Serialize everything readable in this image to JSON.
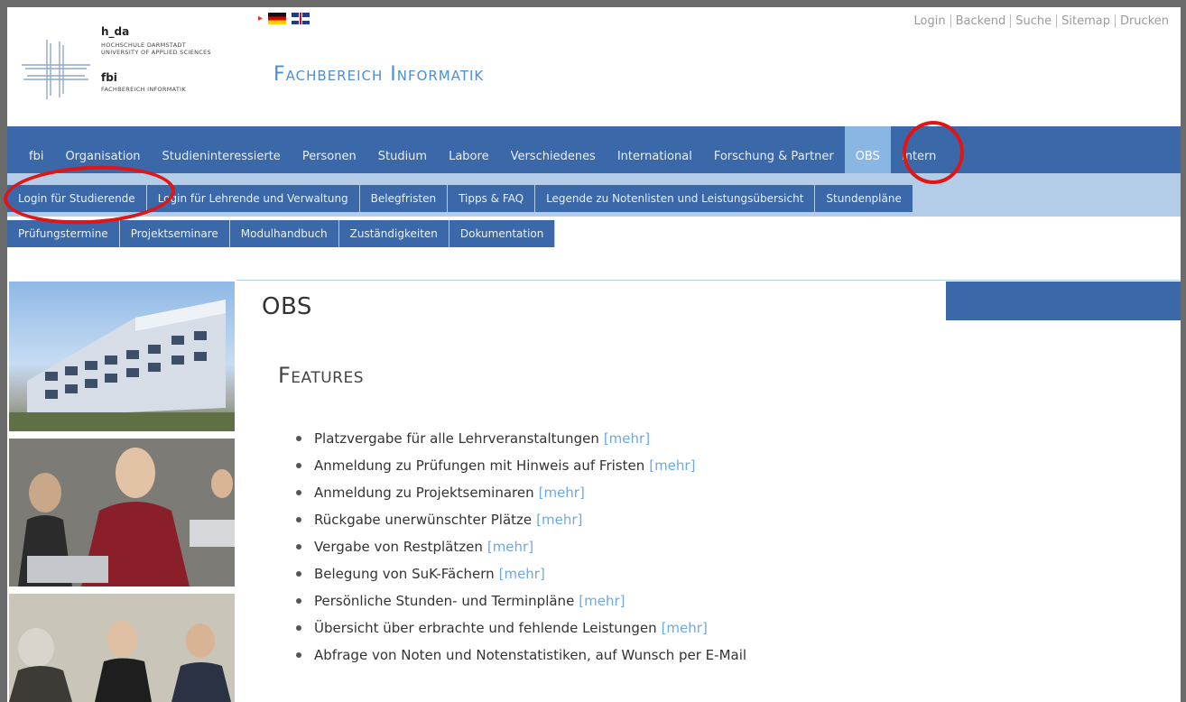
{
  "header": {
    "logo": {
      "hda": "h_da",
      "line1": "HOCHSCHULE DARMSTADT",
      "line2": "UNIVERSITY OF APPLIED SCIENCES",
      "fbi": "fbi",
      "fbi_sub": "FACHBEREICH INFORMATIK"
    },
    "site_title": "Fachbereich Informatik",
    "top_links": [
      "Login",
      "Backend",
      "Suche",
      "Sitemap",
      "Drucken"
    ]
  },
  "main_nav": {
    "items": [
      "fbi",
      "Organisation",
      "Studieninteressierte",
      "Personen",
      "Studium",
      "Labore",
      "Verschiedenes",
      "International",
      "Forschung & Partner",
      "OBS",
      "Intern"
    ],
    "active": "OBS"
  },
  "sub_nav": {
    "row1": [
      "Login für Studierende",
      "Login für Lehrende und Verwaltung",
      "Belegfristen",
      "Tipps & FAQ",
      "Legende zu Notenlisten und Leistungsübersicht",
      "Stundenpläne"
    ],
    "row2": [
      "Prüfungstermine",
      "Projektseminare",
      "Modulhandbuch",
      "Zuständigkeiten",
      "Dokumentation"
    ]
  },
  "content": {
    "page_title": "OBS",
    "section_title": "Features",
    "more_label": "[mehr]",
    "features": [
      {
        "text": "Platzvergabe für alle Lehrveranstaltungen",
        "more": true
      },
      {
        "text": "Anmeldung zu Prüfungen mit Hinweis auf Fristen",
        "more": true
      },
      {
        "text": "Anmeldung zu Projektseminaren",
        "more": true
      },
      {
        "text": "Rückgabe unerwünschter Plätze",
        "more": true
      },
      {
        "text": "Vergabe von Restplätzen",
        "more": true
      },
      {
        "text": "Belegung von SuK-Fächern",
        "more": true
      },
      {
        "text": "Persönliche Stunden- und Terminpläne",
        "more": true
      },
      {
        "text": "Übersicht über erbrachte und fehlende Leistungen",
        "more": true
      },
      {
        "text": "Abfrage von Noten und Notenstatistiken, auf Wunsch per E-Mail",
        "more": false
      }
    ]
  },
  "colors": {
    "nav_blue": "#3b68a8",
    "light_blue": "#b3cde9",
    "title_blue": "#4a8fd4",
    "link_blue": "#6da8e0",
    "highlight_red": "#e01515"
  }
}
